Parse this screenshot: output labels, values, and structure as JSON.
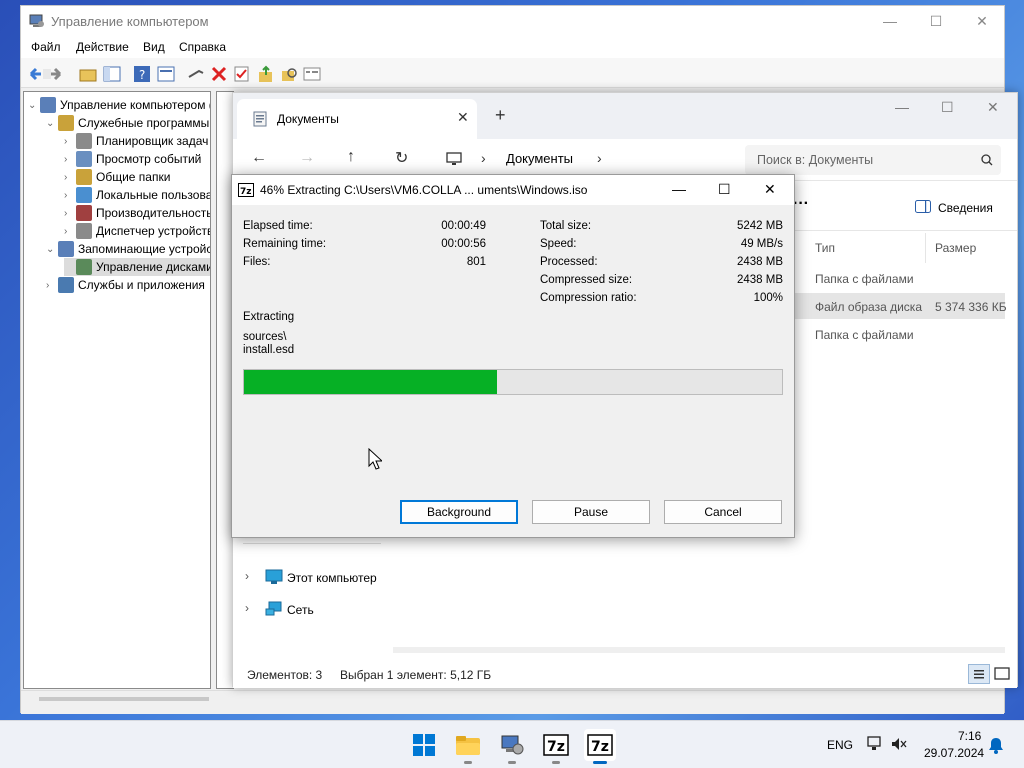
{
  "computer_management": {
    "title": "Управление компьютером",
    "menu": [
      "Файл",
      "Действие",
      "Вид",
      "Справка"
    ],
    "tree": [
      {
        "label": "Управление компьютером (л",
        "level": 0
      },
      {
        "label": "Служебные программы",
        "level": 1
      },
      {
        "label": "Планировщик задач",
        "level": 2
      },
      {
        "label": "Просмотр событий",
        "level": 2
      },
      {
        "label": "Общие папки",
        "level": 2
      },
      {
        "label": "Локальные пользовате",
        "level": 2
      },
      {
        "label": "Производительность",
        "level": 2
      },
      {
        "label": "Диспетчер устройств",
        "level": 2
      },
      {
        "label": "Запоминающие устройст",
        "level": 1
      },
      {
        "label": "Управление дисками",
        "level": 2,
        "selected": true
      },
      {
        "label": "Службы и приложения",
        "level": 1
      }
    ]
  },
  "explorer": {
    "tab_title": "Документы",
    "breadcrumb": "Документы",
    "search_placeholder": "Поиск в: Документы",
    "details_label": "Сведения",
    "columns": {
      "type": "Тип",
      "size": "Размер"
    },
    "rows": [
      {
        "type": "Папка с файлами",
        "size": ""
      },
      {
        "type": "Файл образа диска",
        "size": "5 374 336 КБ",
        "selected": true
      },
      {
        "type": "Папка с файлами",
        "size": ""
      }
    ],
    "nav": [
      "Этот компьютер",
      "Сеть"
    ],
    "status_items": "Элементов: 3",
    "status_selected": "Выбран 1 элемент: 5,12 ГБ"
  },
  "sevenzip": {
    "title": "46% Extracting C:\\Users\\VM6.COLLA ... uments\\Windows.iso",
    "left_stats": [
      {
        "label": "Elapsed time:",
        "value": "00:00:49"
      },
      {
        "label": "Remaining time:",
        "value": "00:00:56"
      },
      {
        "label": "Files:",
        "value": "801"
      }
    ],
    "right_stats": [
      {
        "label": "Total size:",
        "value": "5242 MB"
      },
      {
        "label": "Speed:",
        "value": "49 MB/s"
      },
      {
        "label": "Processed:",
        "value": "2438 MB"
      },
      {
        "label": "Compressed size:",
        "value": "2438 MB"
      },
      {
        "label": "Compression ratio:",
        "value": "100%"
      }
    ],
    "operation": "Extracting",
    "current_dir": "sources\\",
    "current_file": "install.esd",
    "progress": 0.47,
    "buttons": {
      "background": "Background",
      "pause": "Pause",
      "cancel": "Cancel"
    }
  },
  "taskbar": {
    "language": "ENG",
    "time": "7:16",
    "date": "29.07.2024"
  },
  "colors": {
    "progress": "#06b025",
    "accent": "#0067c0"
  }
}
